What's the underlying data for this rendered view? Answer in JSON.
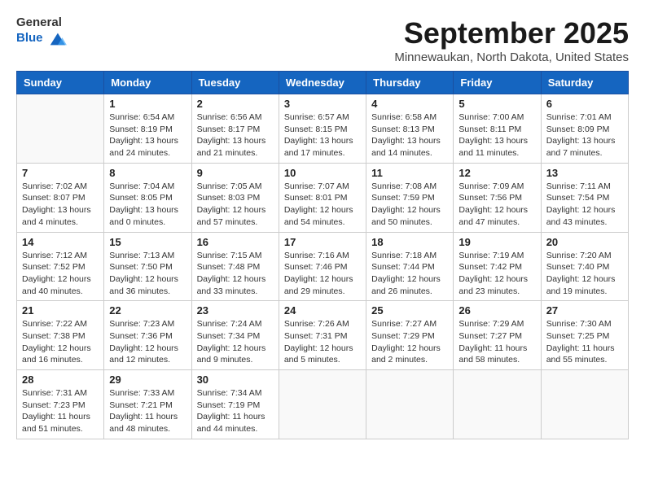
{
  "logo": {
    "general": "General",
    "blue": "Blue"
  },
  "header": {
    "month": "September 2025",
    "location": "Minnewaukan, North Dakota, United States"
  },
  "days_of_week": [
    "Sunday",
    "Monday",
    "Tuesday",
    "Wednesday",
    "Thursday",
    "Friday",
    "Saturday"
  ],
  "weeks": [
    [
      {
        "day": "",
        "info": ""
      },
      {
        "day": "1",
        "info": "Sunrise: 6:54 AM\nSunset: 8:19 PM\nDaylight: 13 hours\nand 24 minutes."
      },
      {
        "day": "2",
        "info": "Sunrise: 6:56 AM\nSunset: 8:17 PM\nDaylight: 13 hours\nand 21 minutes."
      },
      {
        "day": "3",
        "info": "Sunrise: 6:57 AM\nSunset: 8:15 PM\nDaylight: 13 hours\nand 17 minutes."
      },
      {
        "day": "4",
        "info": "Sunrise: 6:58 AM\nSunset: 8:13 PM\nDaylight: 13 hours\nand 14 minutes."
      },
      {
        "day": "5",
        "info": "Sunrise: 7:00 AM\nSunset: 8:11 PM\nDaylight: 13 hours\nand 11 minutes."
      },
      {
        "day": "6",
        "info": "Sunrise: 7:01 AM\nSunset: 8:09 PM\nDaylight: 13 hours\nand 7 minutes."
      }
    ],
    [
      {
        "day": "7",
        "info": "Sunrise: 7:02 AM\nSunset: 8:07 PM\nDaylight: 13 hours\nand 4 minutes."
      },
      {
        "day": "8",
        "info": "Sunrise: 7:04 AM\nSunset: 8:05 PM\nDaylight: 13 hours\nand 0 minutes."
      },
      {
        "day": "9",
        "info": "Sunrise: 7:05 AM\nSunset: 8:03 PM\nDaylight: 12 hours\nand 57 minutes."
      },
      {
        "day": "10",
        "info": "Sunrise: 7:07 AM\nSunset: 8:01 PM\nDaylight: 12 hours\nand 54 minutes."
      },
      {
        "day": "11",
        "info": "Sunrise: 7:08 AM\nSunset: 7:59 PM\nDaylight: 12 hours\nand 50 minutes."
      },
      {
        "day": "12",
        "info": "Sunrise: 7:09 AM\nSunset: 7:56 PM\nDaylight: 12 hours\nand 47 minutes."
      },
      {
        "day": "13",
        "info": "Sunrise: 7:11 AM\nSunset: 7:54 PM\nDaylight: 12 hours\nand 43 minutes."
      }
    ],
    [
      {
        "day": "14",
        "info": "Sunrise: 7:12 AM\nSunset: 7:52 PM\nDaylight: 12 hours\nand 40 minutes."
      },
      {
        "day": "15",
        "info": "Sunrise: 7:13 AM\nSunset: 7:50 PM\nDaylight: 12 hours\nand 36 minutes."
      },
      {
        "day": "16",
        "info": "Sunrise: 7:15 AM\nSunset: 7:48 PM\nDaylight: 12 hours\nand 33 minutes."
      },
      {
        "day": "17",
        "info": "Sunrise: 7:16 AM\nSunset: 7:46 PM\nDaylight: 12 hours\nand 29 minutes."
      },
      {
        "day": "18",
        "info": "Sunrise: 7:18 AM\nSunset: 7:44 PM\nDaylight: 12 hours\nand 26 minutes."
      },
      {
        "day": "19",
        "info": "Sunrise: 7:19 AM\nSunset: 7:42 PM\nDaylight: 12 hours\nand 23 minutes."
      },
      {
        "day": "20",
        "info": "Sunrise: 7:20 AM\nSunset: 7:40 PM\nDaylight: 12 hours\nand 19 minutes."
      }
    ],
    [
      {
        "day": "21",
        "info": "Sunrise: 7:22 AM\nSunset: 7:38 PM\nDaylight: 12 hours\nand 16 minutes."
      },
      {
        "day": "22",
        "info": "Sunrise: 7:23 AM\nSunset: 7:36 PM\nDaylight: 12 hours\nand 12 minutes."
      },
      {
        "day": "23",
        "info": "Sunrise: 7:24 AM\nSunset: 7:34 PM\nDaylight: 12 hours\nand 9 minutes."
      },
      {
        "day": "24",
        "info": "Sunrise: 7:26 AM\nSunset: 7:31 PM\nDaylight: 12 hours\nand 5 minutes."
      },
      {
        "day": "25",
        "info": "Sunrise: 7:27 AM\nSunset: 7:29 PM\nDaylight: 12 hours\nand 2 minutes."
      },
      {
        "day": "26",
        "info": "Sunrise: 7:29 AM\nSunset: 7:27 PM\nDaylight: 11 hours\nand 58 minutes."
      },
      {
        "day": "27",
        "info": "Sunrise: 7:30 AM\nSunset: 7:25 PM\nDaylight: 11 hours\nand 55 minutes."
      }
    ],
    [
      {
        "day": "28",
        "info": "Sunrise: 7:31 AM\nSunset: 7:23 PM\nDaylight: 11 hours\nand 51 minutes."
      },
      {
        "day": "29",
        "info": "Sunrise: 7:33 AM\nSunset: 7:21 PM\nDaylight: 11 hours\nand 48 minutes."
      },
      {
        "day": "30",
        "info": "Sunrise: 7:34 AM\nSunset: 7:19 PM\nDaylight: 11 hours\nand 44 minutes."
      },
      {
        "day": "",
        "info": ""
      },
      {
        "day": "",
        "info": ""
      },
      {
        "day": "",
        "info": ""
      },
      {
        "day": "",
        "info": ""
      }
    ]
  ]
}
